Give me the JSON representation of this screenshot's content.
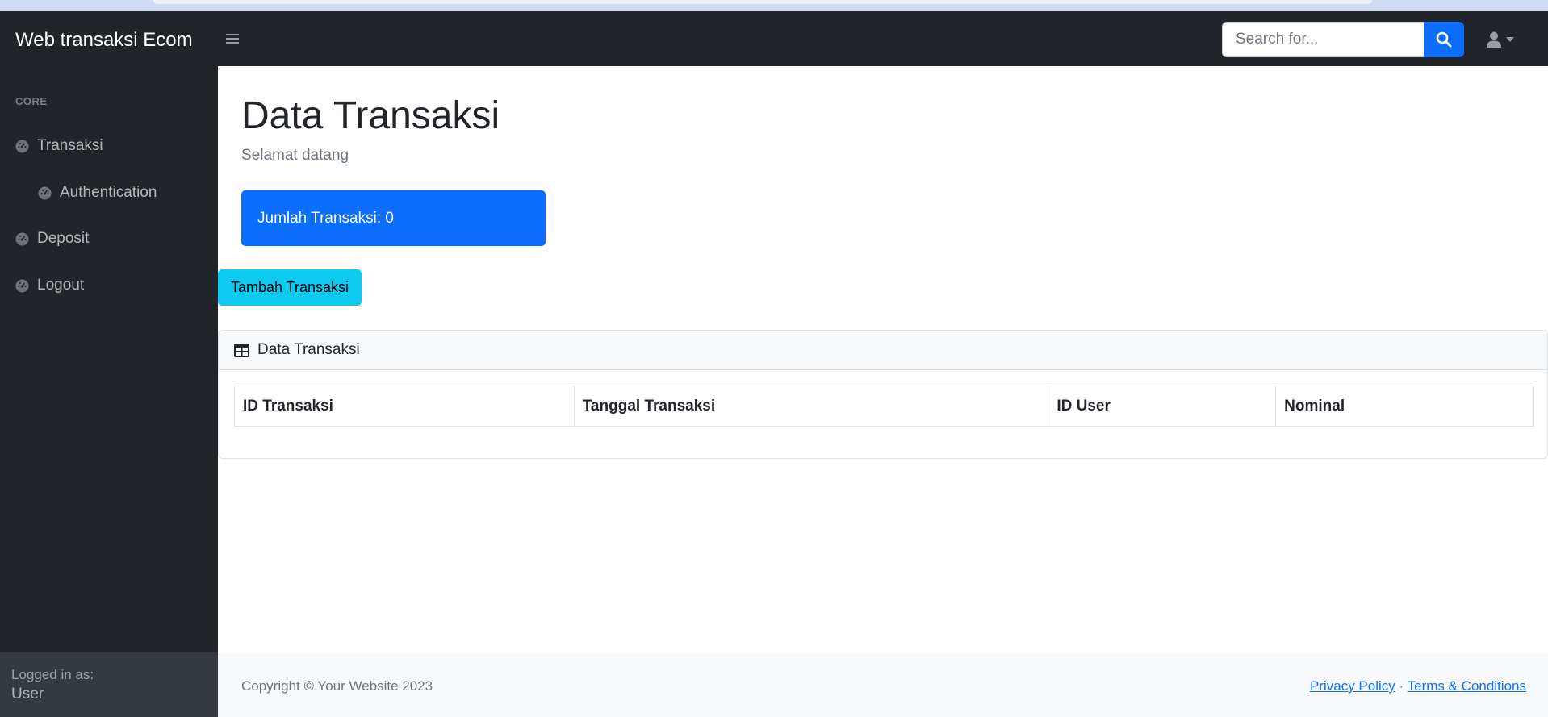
{
  "navbar": {
    "brand": "Web transaksi Ecom",
    "toggle_icon": "bars-icon",
    "search_placeholder": "Search for...",
    "search_icon": "search-icon",
    "user_icon": "user-icon"
  },
  "sidebar": {
    "heading": "CORE",
    "items": [
      {
        "label": "Transaksi",
        "icon": "tachometer-icon"
      },
      {
        "label": "Authentication",
        "icon": "tachometer-icon"
      },
      {
        "label": "Deposit",
        "icon": "tachometer-icon"
      },
      {
        "label": "Logout",
        "icon": "tachometer-icon"
      }
    ],
    "footer": {
      "logged_in_label": "Logged in as:",
      "user": "User"
    }
  },
  "main": {
    "title": "Data Transaksi",
    "subtitle": "Selamat datang",
    "stat_card": "Jumlah Transaksi: 0",
    "add_button": "Tambah Transaksi",
    "card": {
      "header": "Data Transaksi",
      "header_icon": "table-icon",
      "columns": [
        "ID Transaksi",
        "Tanggal Transaksi",
        "ID User",
        "Nominal"
      ]
    }
  },
  "footer": {
    "copyright": "Copyright © Your Website 2023",
    "links": [
      "Privacy Policy",
      "Terms & Conditions"
    ],
    "separator": "·"
  },
  "colors": {
    "dark": "#212529",
    "primary": "#0d6efd",
    "info": "#0dcaf0",
    "light": "#f8f9fa"
  }
}
